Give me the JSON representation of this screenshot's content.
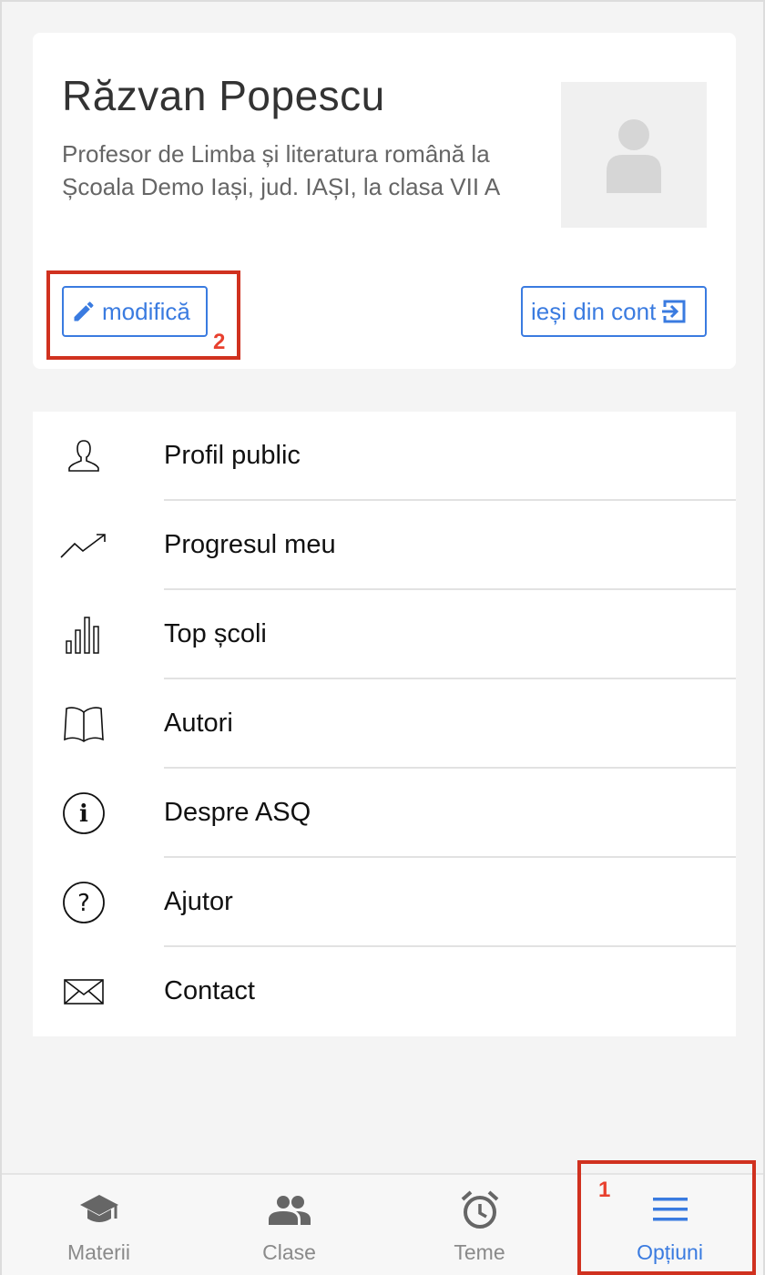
{
  "profile": {
    "name": "Răzvan Popescu",
    "description": "Profesor de Limba și literatura română la Școala Demo Iași, jud. IAȘI, la clasa VII A",
    "edit_label": "modifică",
    "logout_label": "ieși din cont"
  },
  "annotations": {
    "step1": "1",
    "step2": "2"
  },
  "menu": {
    "items": [
      {
        "label": "Profil public",
        "icon": "person-outline-icon"
      },
      {
        "label": "Progresul meu",
        "icon": "trend-up-icon"
      },
      {
        "label": "Top școli",
        "icon": "bar-chart-icon"
      },
      {
        "label": "Autori",
        "icon": "open-book-icon"
      },
      {
        "label": "Despre ASQ",
        "icon": "info-icon"
      },
      {
        "label": "Ajutor",
        "icon": "question-icon"
      },
      {
        "label": "Contact",
        "icon": "envelope-icon"
      }
    ]
  },
  "tabbar": {
    "tabs": [
      {
        "label": "Materii",
        "icon": "graduation-cap-icon"
      },
      {
        "label": "Clase",
        "icon": "people-icon"
      },
      {
        "label": "Teme",
        "icon": "alarm-clock-icon"
      },
      {
        "label": "Opțiuni",
        "icon": "menu-icon"
      }
    ],
    "active": "Opțiuni"
  },
  "colors": {
    "accent": "#3a7be0",
    "highlight": "#d0311f",
    "background": "#f4f4f4"
  }
}
